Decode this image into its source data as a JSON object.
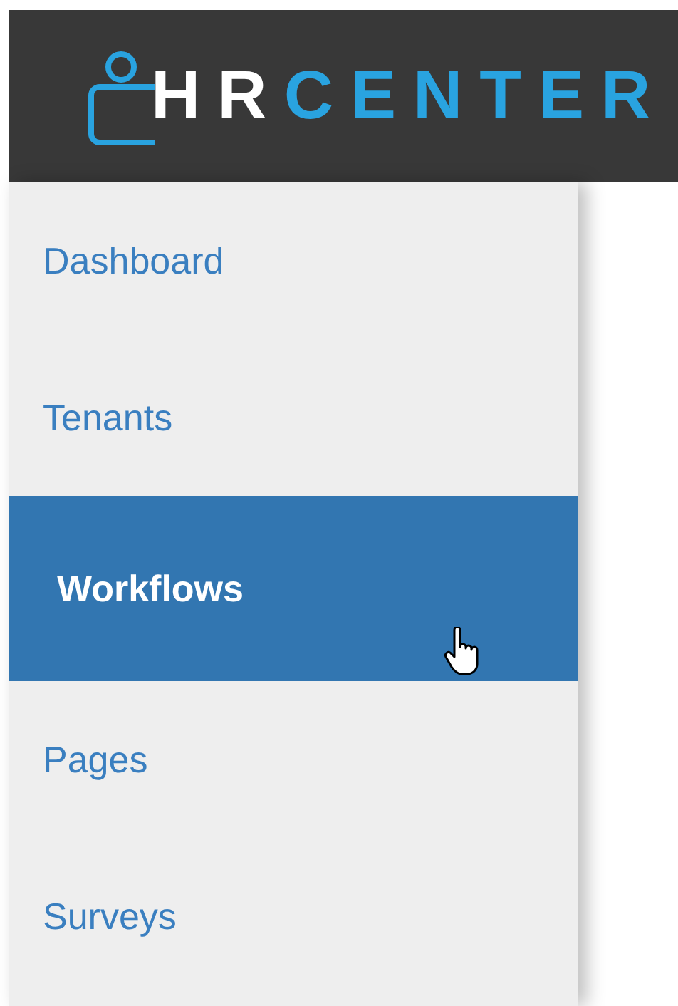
{
  "header": {
    "logo_part_1": "HR",
    "logo_part_2": "CENTER"
  },
  "sidebar": {
    "items": [
      {
        "label": "Dashboard",
        "selected": false
      },
      {
        "label": "Tenants",
        "selected": false
      },
      {
        "label": "Workflows",
        "selected": true
      },
      {
        "label": "Pages",
        "selected": false
      },
      {
        "label": "Surveys",
        "selected": false
      }
    ]
  }
}
